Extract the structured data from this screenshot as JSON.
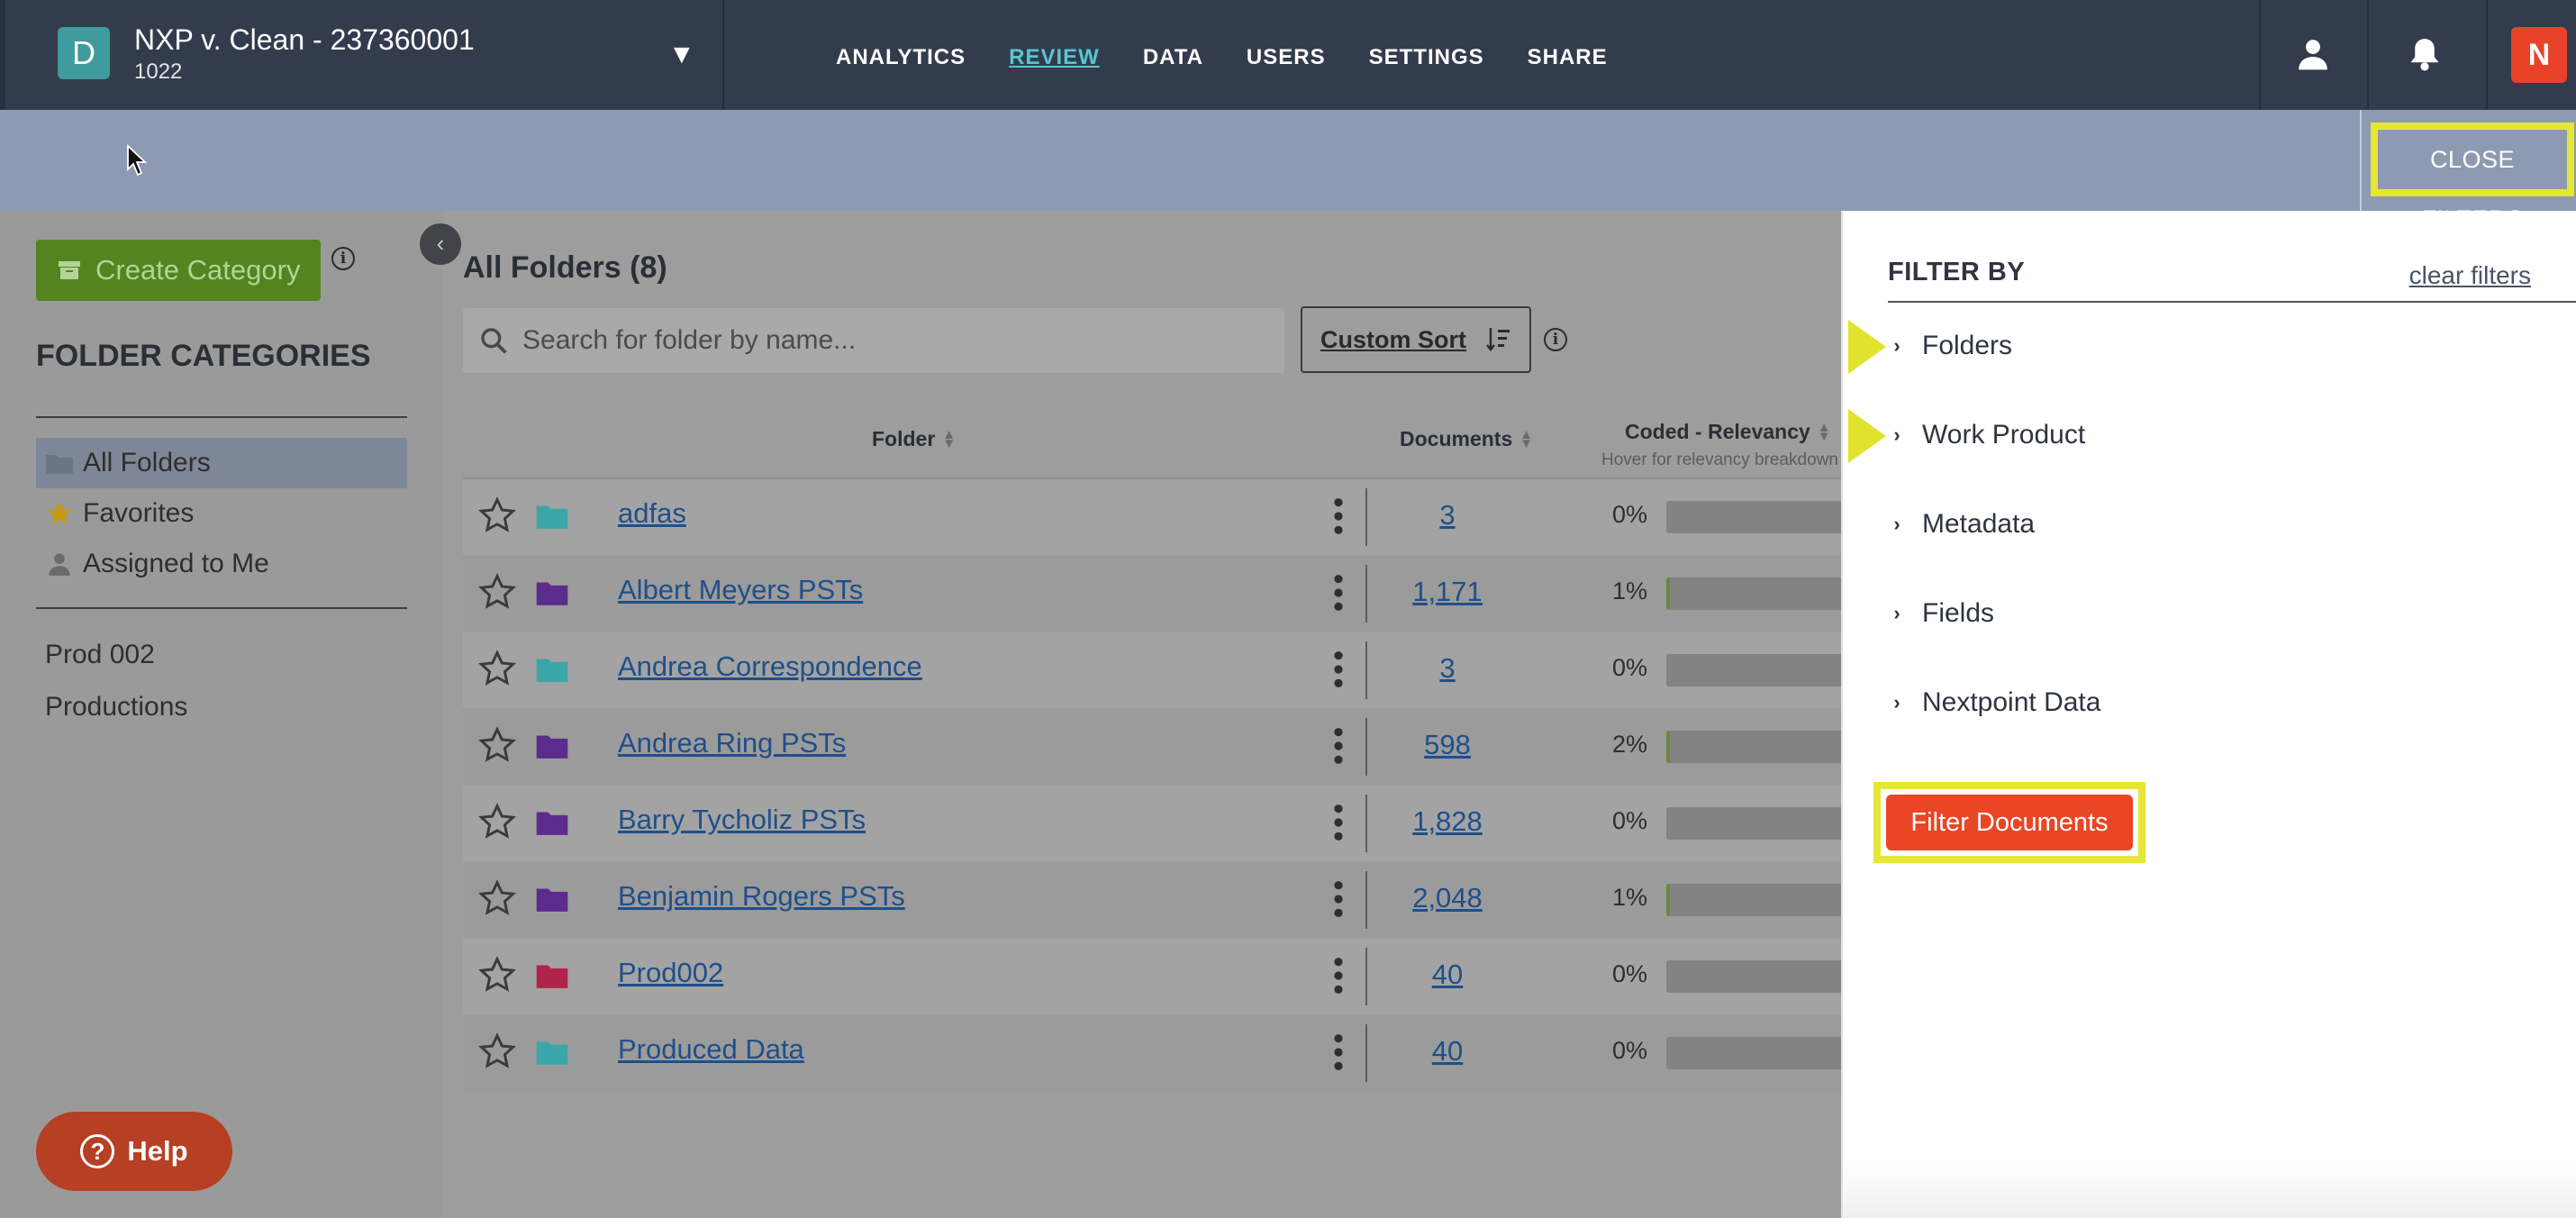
{
  "header": {
    "case_initial": "D",
    "case_title": "NXP v. Clean - 237360001",
    "case_subtitle": "1022",
    "toggle_glyph": "▼",
    "nav": [
      {
        "label": "ANALYTICS",
        "active": false
      },
      {
        "label": "REVIEW",
        "active": true
      },
      {
        "label": "DATA",
        "active": false
      },
      {
        "label": "USERS",
        "active": false
      },
      {
        "label": "SETTINGS",
        "active": false
      },
      {
        "label": "SHARE",
        "active": false
      }
    ],
    "icons": [
      "user-icon",
      "bell-icon",
      "nextpoint-logo-icon"
    ],
    "brand_glyph": "N"
  },
  "filterbar": {
    "close_label": "CLOSE FILTERS"
  },
  "sidebar": {
    "create_label": "Create Category",
    "heading": "FOLDER CATEGORIES",
    "items": [
      {
        "label": "All Folders",
        "icon": "folder-icon"
      },
      {
        "label": "Favorites",
        "icon": "star-icon"
      },
      {
        "label": "Assigned to Me",
        "icon": "person-icon"
      }
    ],
    "links": [
      "Prod 002",
      "Productions"
    ],
    "help_label": "Help"
  },
  "main": {
    "title": "All Folders (8)",
    "search_placeholder": "Search for folder by name...",
    "sort_label": "Custom Sort",
    "columns": {
      "folder": "Folder",
      "documents": "Documents",
      "coded": "Coded - Relevancy",
      "coded_sub": "Hover for relevancy breakdown"
    },
    "rows": [
      {
        "name": "adfas",
        "docs": "3",
        "pct": "0%",
        "fill": 0,
        "folder_color": "#3aa6a8"
      },
      {
        "name": "Albert Meyers PSTs",
        "docs": "1,171",
        "pct": "1%",
        "fill": 0.01,
        "folder_color": "#5b2c8c"
      },
      {
        "name": "Andrea Correspondence",
        "docs": "3",
        "pct": "0%",
        "fill": 0,
        "folder_color": "#3aa6a8"
      },
      {
        "name": "Andrea Ring PSTs",
        "docs": "598",
        "pct": "2%",
        "fill": 0.02,
        "folder_color": "#5b2c8c"
      },
      {
        "name": "Barry Tycholiz PSTs",
        "docs": "1,828",
        "pct": "0%",
        "fill": 0,
        "folder_color": "#5b2c8c"
      },
      {
        "name": "Benjamin Rogers PSTs",
        "docs": "2,048",
        "pct": "1%",
        "fill": 0.01,
        "folder_color": "#5b2c8c"
      },
      {
        "name": "Prod002",
        "docs": "40",
        "pct": "0%",
        "fill": 0,
        "folder_color": "#b0244a"
      },
      {
        "name": "Produced Data",
        "docs": "40",
        "pct": "0%",
        "fill": 0,
        "folder_color": "#3aa6a8"
      }
    ]
  },
  "panel": {
    "title": "FILTER BY",
    "clear_label": "clear filters",
    "items": [
      "Folders",
      "Work Product",
      "Metadata",
      "Fields",
      "Nextpoint Data"
    ],
    "pointed_items": [
      "Folders",
      "Work Product"
    ],
    "submit_label": "Filter Documents"
  },
  "colors": {
    "accent_teal": "#59c6cf",
    "highlight_yellow": "#e5e635",
    "submit_orange": "#ea4524",
    "nav_bg": "#323c4c"
  }
}
